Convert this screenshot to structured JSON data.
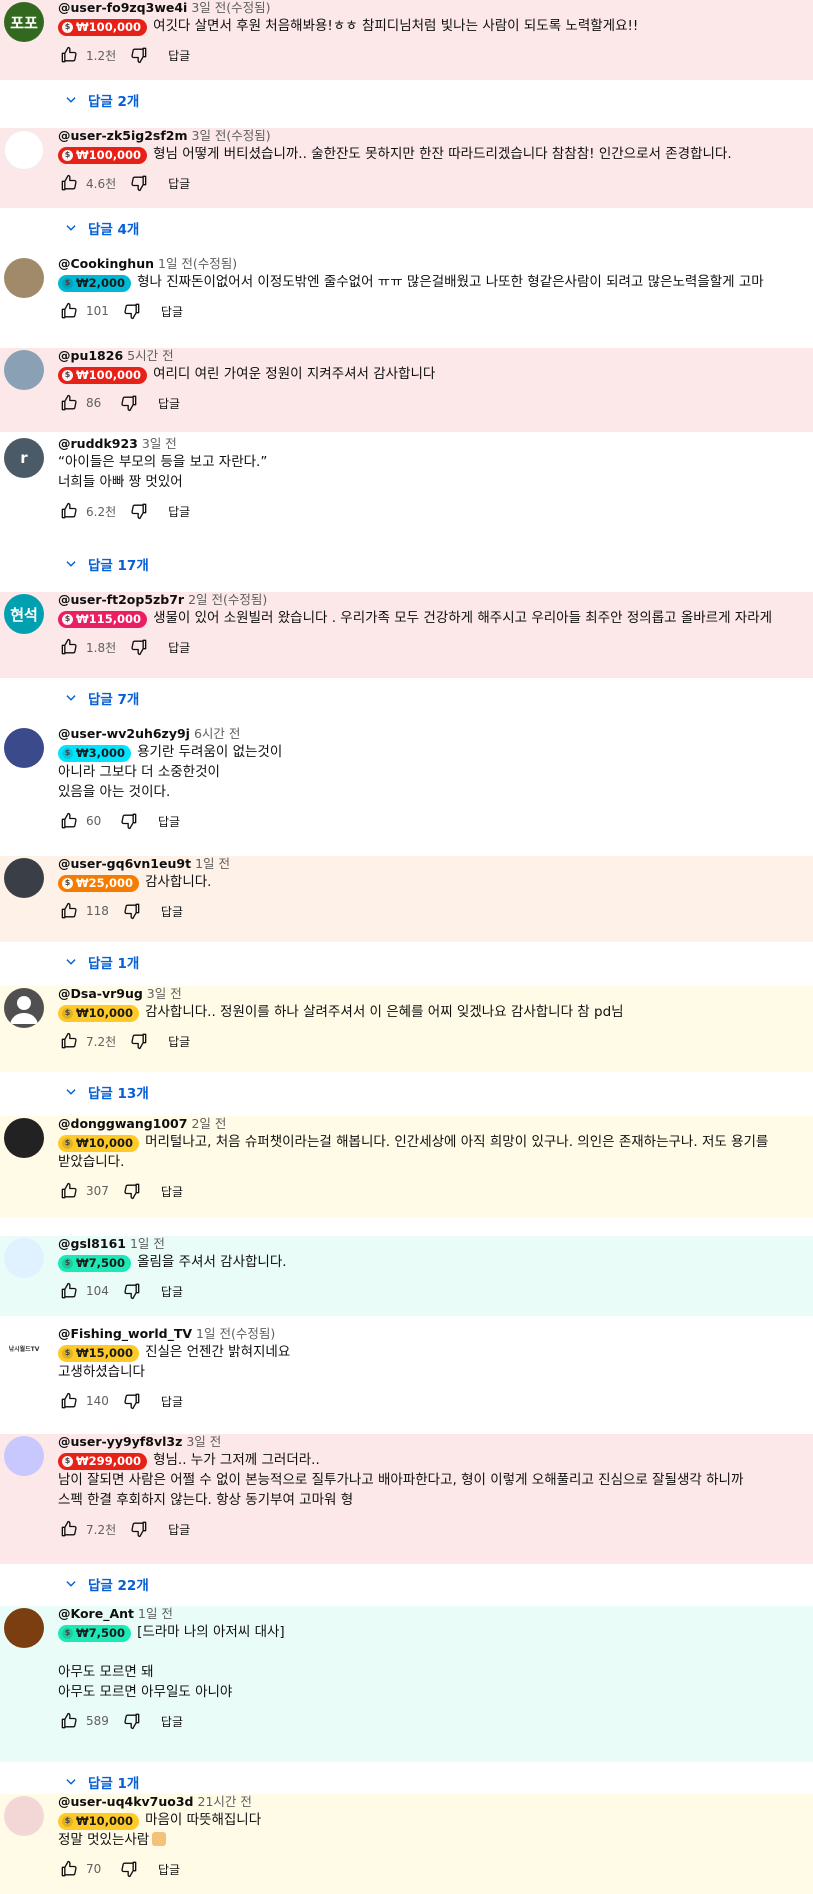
{
  "reply_label": "답글",
  "comments": [
    {
      "handle": "@user-fo9zq3we4i",
      "time": "3일 전(수정됨)",
      "avatar_text": "포포",
      "amount": "₩100,000",
      "lines": [
        "여깃다 살면서 후원 처음해봐용!ㅎㅎ 참피디님처럼 빛나는 사람이 되도록 노력할게요!!"
      ],
      "likes": "1.2천",
      "replies": "답글 2개"
    },
    {
      "handle": "@user-zk5ig2sf2m",
      "time": "3일 전(수정됨)",
      "avatar_text": "",
      "amount": "₩100,000",
      "lines": [
        "형님 어떻게 버티셨습니까.. 술한잔도 못하지만 한잔 따라드리겠습니다 참참참! 인간으로서 존경합니다."
      ],
      "likes": "4.6천",
      "replies": "답글 4개"
    },
    {
      "handle": "@Cookinghun",
      "time": "1일 전(수정됨)",
      "avatar_text": "",
      "amount": "₩2,000",
      "lines": [
        "형나 진짜돈이없어서 이정도밖엔 줄수없어 ㅠㅠ 많은걸배웠고 나또한 형같은사람이 되려고 많은노력을할게 고마"
      ],
      "likes": "101",
      "replies": ""
    },
    {
      "handle": "@pu1826",
      "time": "5시간 전",
      "avatar_text": "",
      "amount": "₩100,000",
      "lines": [
        "여리디 여린 가여운 정원이 지켜주셔서 감사합니다"
      ],
      "likes": "86",
      "replies": ""
    },
    {
      "handle": "@ruddk923",
      "time": "3일 전",
      "avatar_text": "r",
      "amount": "",
      "lines": [
        "“아이들은 부모의 등을 보고 자란다.”",
        "너희들 아빠 짱 멋있어"
      ],
      "likes": "6.2천",
      "replies": "답글 17개"
    },
    {
      "handle": "@user-ft2op5zb7r",
      "time": "2일 전(수정됨)",
      "avatar_text": "현석",
      "amount": "₩115,000",
      "lines": [
        "생물이 있어 소원빌러 왔습니다 . 우리가족 모두 건강하게 해주시고 우리아들 최주안 정의롭고 올바르게 자라게"
      ],
      "likes": "1.8천",
      "replies": "답글 7개"
    },
    {
      "handle": "@user-wv2uh6zy9j",
      "time": "6시간 전",
      "avatar_text": "",
      "amount": "₩3,000",
      "lines": [
        "용기란 두려움이 없는것이",
        "아니라 그보다 더 소중한것이",
        "있음을 아는 것이다."
      ],
      "likes": "60",
      "replies": ""
    },
    {
      "handle": "@user-gq6vn1eu9t",
      "time": "1일 전",
      "avatar_text": "",
      "amount": "₩25,000",
      "lines": [
        "감사합니다."
      ],
      "likes": "118",
      "replies": "답글 1개"
    },
    {
      "handle": "@Dsa-vr9ug",
      "time": "3일 전",
      "avatar_text": "",
      "amount": "₩10,000",
      "lines": [
        "감사합니다.. 정원이를 하나 살려주셔서 이 은혜를 어찌 잊겠나요 감사합니다 참 pd님"
      ],
      "likes": "7.2천",
      "replies": "답글 13개"
    },
    {
      "handle": "@donggwang1007",
      "time": "2일 전",
      "avatar_text": "",
      "amount": "₩10,000",
      "lines": [
        "머리털나고, 처음 슈퍼챗이라는걸 해봅니다. 인간세상에 아직 희망이 있구나. 의인은 존재하는구나. 저도 용기를",
        "받았습니다."
      ],
      "likes": "307",
      "replies": ""
    },
    {
      "handle": "@gsl8161",
      "time": "1일 전",
      "avatar_text": "",
      "amount": "₩7,500",
      "lines": [
        "올림을 주셔서 감사합니다."
      ],
      "likes": "104",
      "replies": ""
    },
    {
      "handle": "@Fishing_world_TV",
      "time": "1일 전(수정됨)",
      "avatar_text": "낚시월드TV",
      "amount": "₩15,000",
      "lines": [
        "진실은 언젠간 밝혀지네요",
        "고생하셨습니다"
      ],
      "likes": "140",
      "replies": ""
    },
    {
      "handle": "@user-yy9yf8vl3z",
      "time": "3일 전",
      "avatar_text": "",
      "amount": "₩299,000",
      "lines": [
        "형님.. 누가 그저께 그러더라..",
        "남이 잘되면 사람은 어쩔 수 없이 본능적으로 질투가나고 배아파한다고, 형이 이렇게 오해풀리고 진심으로 잘될생각 하니까",
        "스펙 한결 후회하지 않는다. 항상 동기부여 고마워 형"
      ],
      "likes": "7.2천",
      "replies": "답글 22개"
    },
    {
      "handle": "@Kore_Ant",
      "time": "1일 전",
      "avatar_text": "",
      "amount": "₩7,500",
      "lines": [
        "[드라마 나의 아저씨 대사]",
        "",
        "아무도 모르면 돼",
        "아무도 모르면 아무일도 아니야"
      ],
      "likes": "589",
      "replies": "답글 1개"
    },
    {
      "handle": "@user-uq4kv7uo3d",
      "time": "21시간 전",
      "avatar_text": "",
      "amount": "₩10,000",
      "lines": [
        "마음이 따뜻해집니다",
        "정말 멋있는사람"
      ],
      "likes": "70",
      "replies": ""
    }
  ]
}
